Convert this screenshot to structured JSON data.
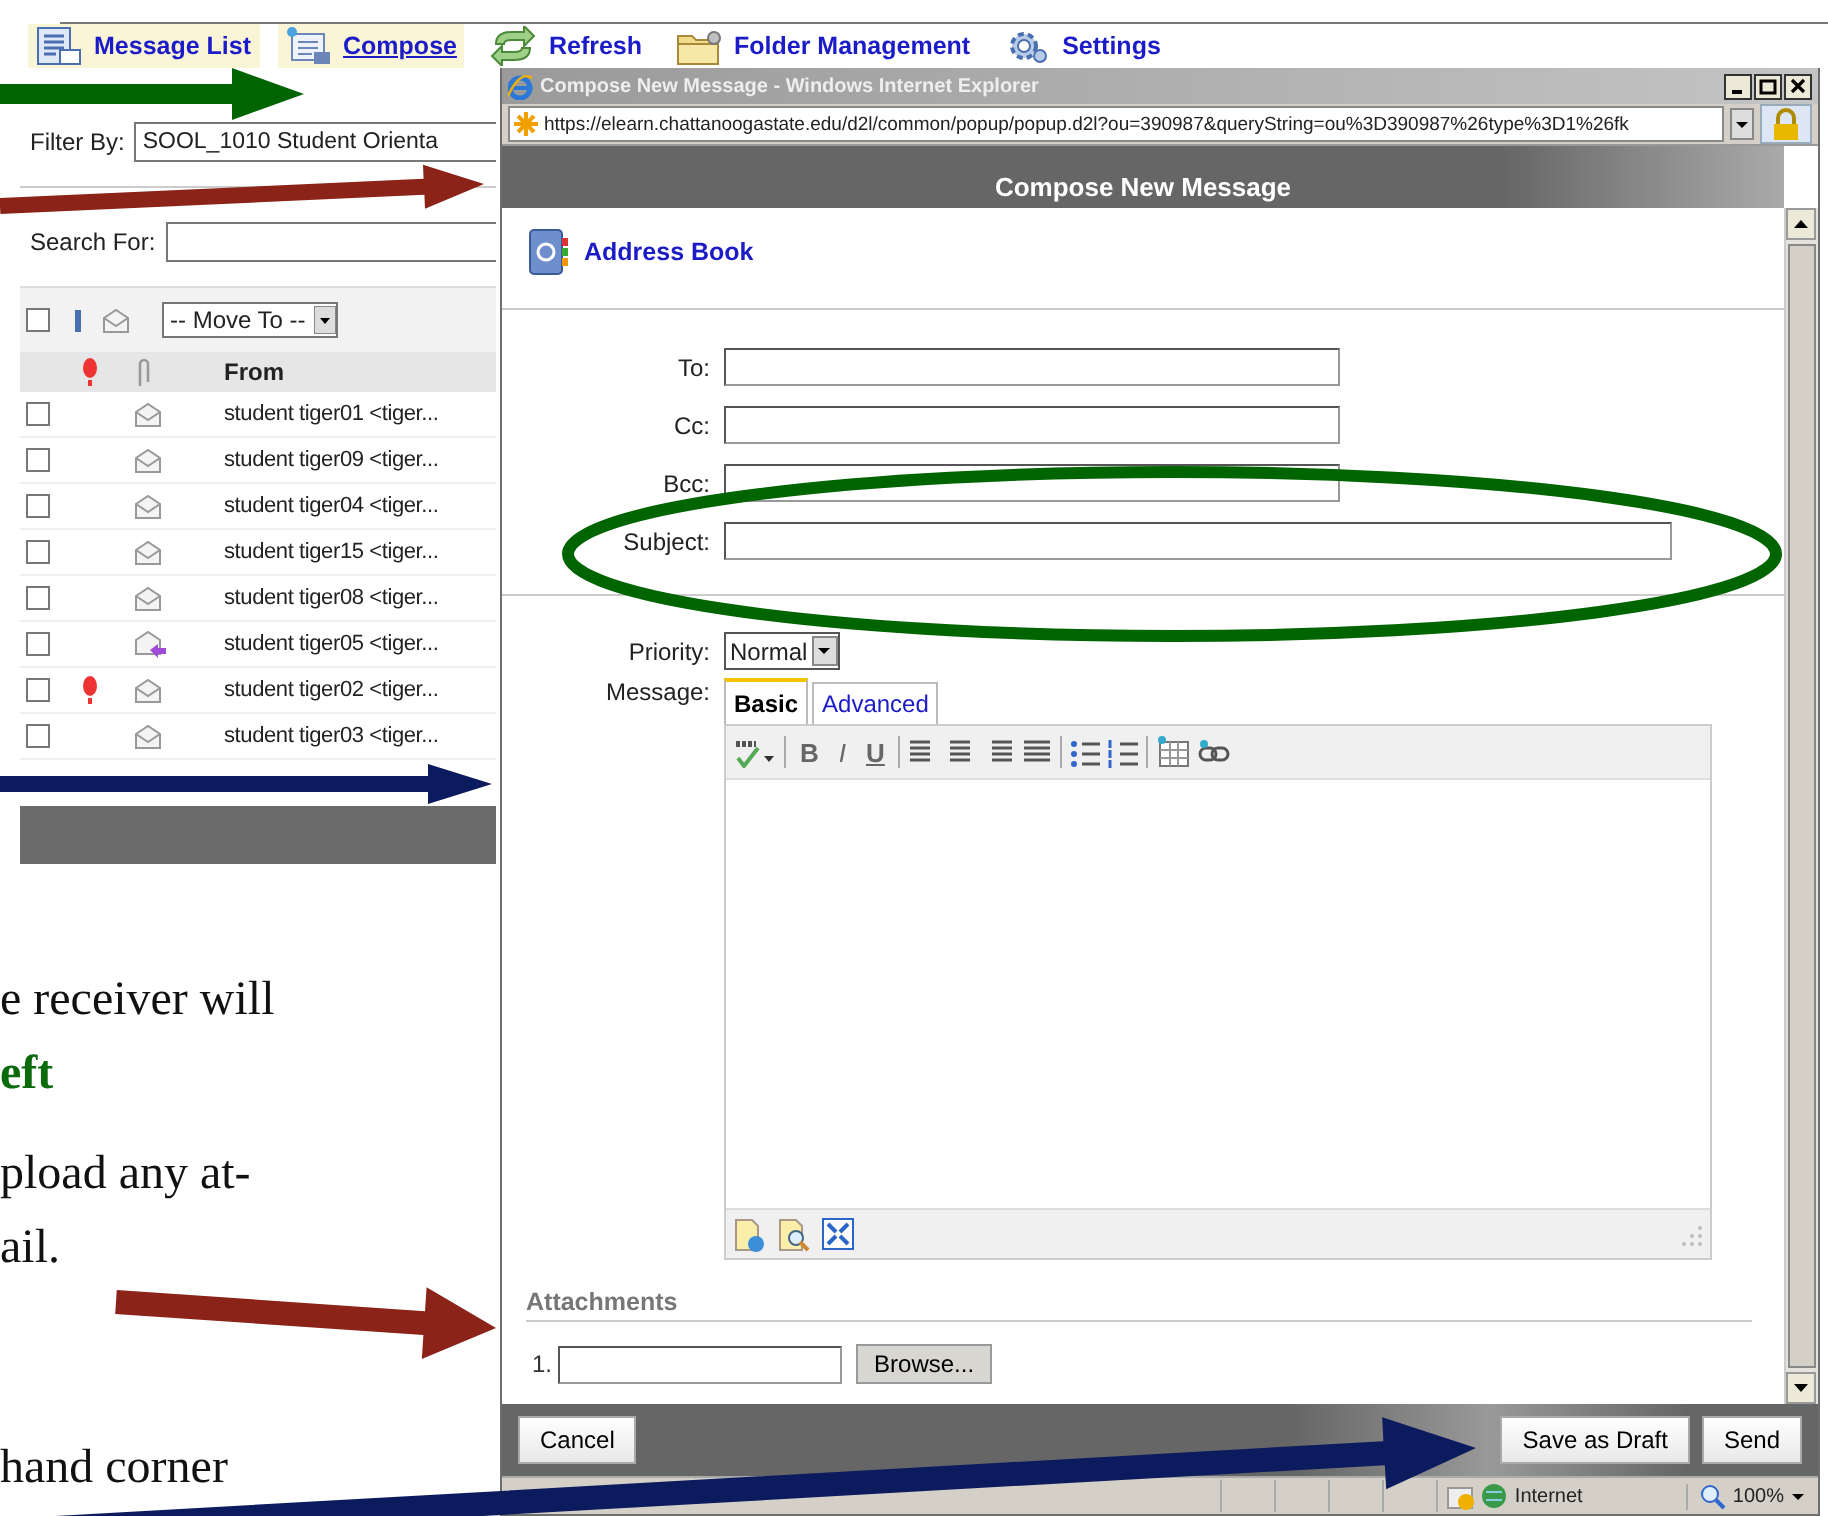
{
  "toolbar": [
    {
      "label": "Message List",
      "kind": "list",
      "highlighted": true,
      "underlined": false
    },
    {
      "label": "Compose",
      "kind": "compose",
      "highlighted": true,
      "underlined": true
    },
    {
      "label": "Refresh",
      "kind": "refresh",
      "highlighted": false,
      "underlined": false
    },
    {
      "label": "Folder Management",
      "kind": "folder",
      "highlighted": false,
      "underlined": false
    },
    {
      "label": "Settings",
      "kind": "settings",
      "highlighted": false,
      "underlined": false
    }
  ],
  "message_list": {
    "filter_label": "Filter By:",
    "filter_value": "SOOL_1010 Student Orienta",
    "search_label": "Search For:",
    "select_all_checked": false,
    "move_to": "-- Move To --",
    "from_header": "From",
    "rows": [
      {
        "checked": false,
        "flagged": false,
        "kind": "read",
        "from": "student tiger01 <tiger..."
      },
      {
        "checked": false,
        "flagged": false,
        "kind": "read",
        "from": "student tiger09 <tiger..."
      },
      {
        "checked": false,
        "flagged": false,
        "kind": "read",
        "from": "student tiger04 <tiger..."
      },
      {
        "checked": false,
        "flagged": false,
        "kind": "read",
        "from": "student tiger15 <tiger..."
      },
      {
        "checked": false,
        "flagged": false,
        "kind": "read",
        "from": "student tiger08 <tiger..."
      },
      {
        "checked": false,
        "flagged": false,
        "kind": "replied",
        "from": "student tiger05 <tiger..."
      },
      {
        "checked": false,
        "flagged": true,
        "kind": "read",
        "from": "student tiger02 <tiger..."
      },
      {
        "checked": false,
        "flagged": false,
        "kind": "read",
        "from": "student tiger03 <tiger..."
      }
    ]
  },
  "document_text": [
    {
      "lines": [
        {
          "text": "e receiver will",
          "kind": "plain"
        },
        {
          "text": "eft",
          "kind": "emphasis"
        }
      ]
    },
    {
      "lines": [
        {
          "text": "pload any at-",
          "kind": "plain"
        },
        {
          "text": "ail.",
          "kind": "plain"
        }
      ]
    },
    {
      "lines": [
        {
          "text": "hand corner",
          "kind": "plain"
        }
      ]
    }
  ],
  "popup": {
    "title": "Compose New Message - Windows Internet Explorer",
    "url": "https://elearn.chattanoogastate.edu/d2l/common/popup/popup.d2l?ou=390987&queryString=ou%3D390987%26type%3D1%26fk",
    "header": "Compose New Message",
    "address_book": "Address Book",
    "fields": [
      {
        "label": "To:",
        "kind": "short"
      },
      {
        "label": "Cc:",
        "kind": "short"
      },
      {
        "label": "Bcc:",
        "kind": "short"
      },
      {
        "label": "Subject:",
        "kind": "long"
      }
    ],
    "priority_label": "Priority:",
    "priority_value": "Normal",
    "message_label": "Message:",
    "tabs": [
      {
        "label": "Basic",
        "selected": true
      },
      {
        "label": "Advanced",
        "selected": false
      }
    ],
    "format_buttons": [
      "B",
      "I",
      "U"
    ],
    "attachments_heading": "Attachments",
    "attachment_number": "1.",
    "browse_button": "Browse...",
    "buttons": [
      {
        "label": "Cancel",
        "kind": "left"
      },
      {
        "label": "Save as Draft",
        "kind": "right"
      },
      {
        "label": "Send",
        "kind": "right"
      }
    ],
    "status_zone": "Internet",
    "zoom": "100%"
  },
  "annotations": [
    {
      "kind": "arrow",
      "color": "#006400"
    },
    {
      "kind": "arrow",
      "color": "#8b2318"
    },
    {
      "kind": "arrow",
      "color": "#0c1b5e"
    },
    {
      "kind": "arrow",
      "color": "#8b2318"
    },
    {
      "kind": "arrow",
      "color": "#0c1b5e"
    },
    {
      "kind": "ellipse",
      "color": "#006400"
    }
  ]
}
